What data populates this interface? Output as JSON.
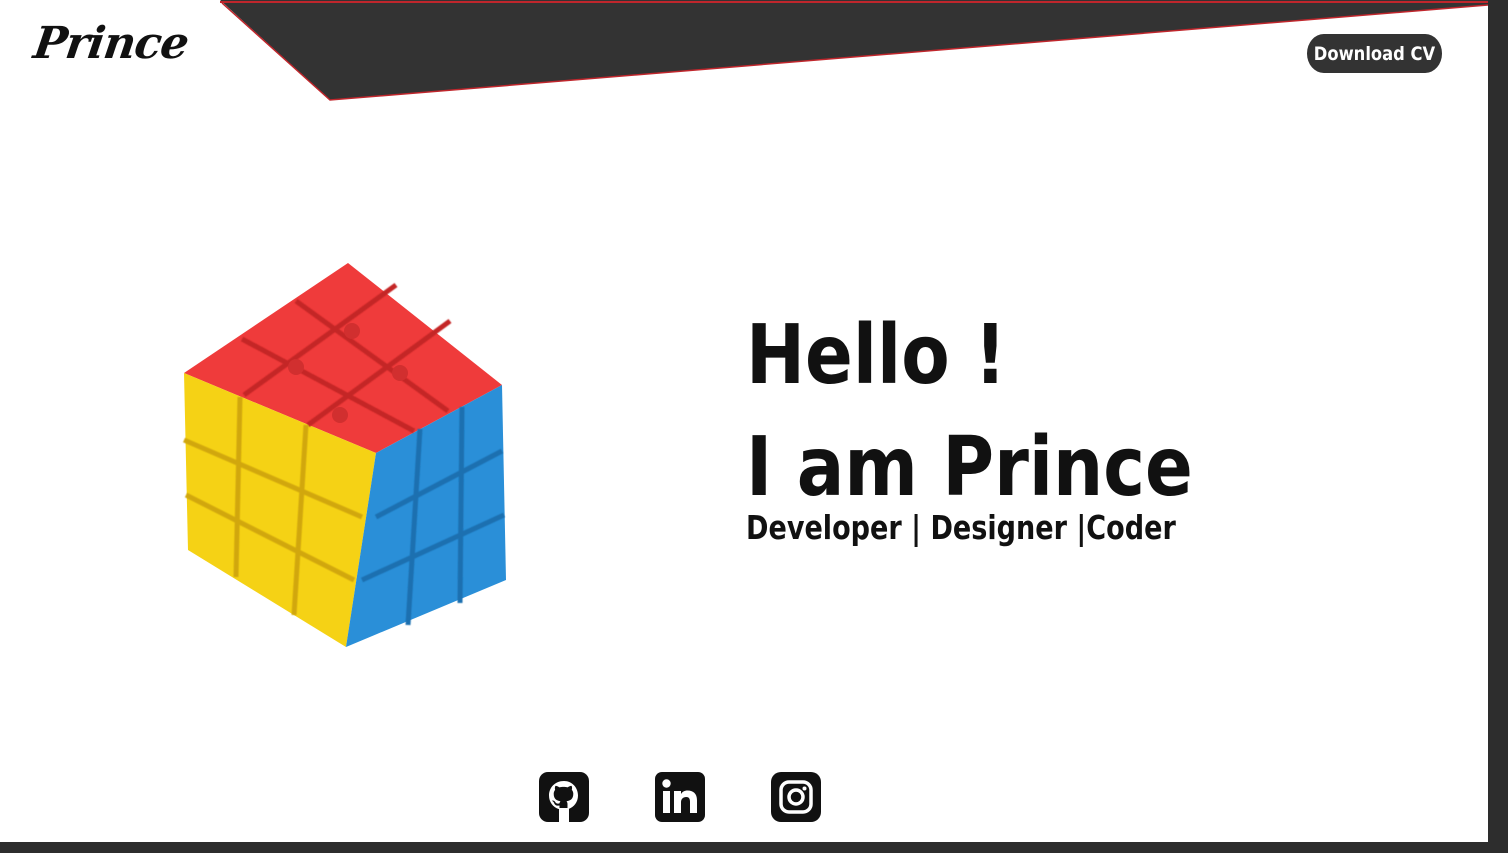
{
  "header": {
    "logo_text": "Prince",
    "cv_button_label": "Download CV"
  },
  "hero": {
    "greeting": "Hello !",
    "intro": "I am Prince",
    "roles": "Developer  |  Designer  |Coder"
  },
  "social": [
    {
      "icon": "github-icon"
    },
    {
      "icon": "linkedin-icon"
    },
    {
      "icon": "instagram-icon"
    }
  ],
  "colors": {
    "frame": "#2d2d2d",
    "header_band": "#333333",
    "accent_line": "#c0262c",
    "text": "#111111",
    "background": "#ffffff"
  }
}
